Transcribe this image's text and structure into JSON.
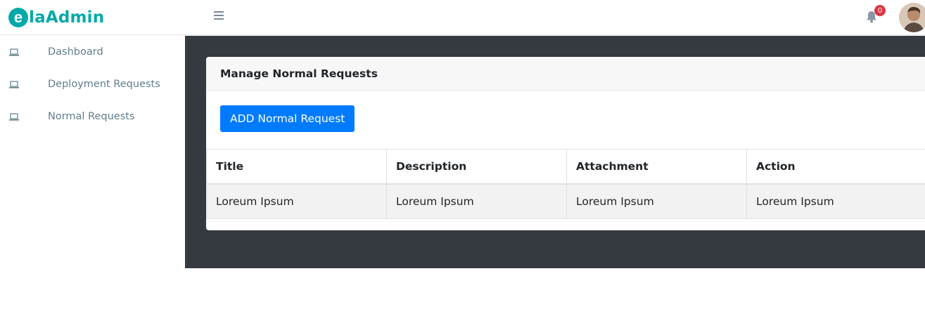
{
  "header": {
    "logo_initial": "e",
    "logo_rest": "la",
    "logo_brand": "Admin",
    "notifications_count": "0"
  },
  "icons": {
    "menu": "hamburger-icon",
    "bell": "bell-icon",
    "nav": "laptop-icon"
  },
  "colors": {
    "brand": "#03a9a9",
    "primary": "#007bff",
    "content_bg": "#343a40",
    "badge": "#dc3545"
  },
  "sidebar": {
    "items": [
      {
        "label": "Dashboard"
      },
      {
        "label": "Deployment Requests"
      },
      {
        "label": "Normal Requests"
      }
    ]
  },
  "main": {
    "card_title": "Manage Normal Requests",
    "add_button": "ADD Normal Request",
    "table": {
      "headers": [
        "Title",
        "Description",
        "Attachment",
        "Action"
      ],
      "rows": [
        [
          "Loreum Ipsum",
          "Loreum Ipsum",
          "Loreum Ipsum",
          "Loreum Ipsum"
        ]
      ]
    }
  }
}
